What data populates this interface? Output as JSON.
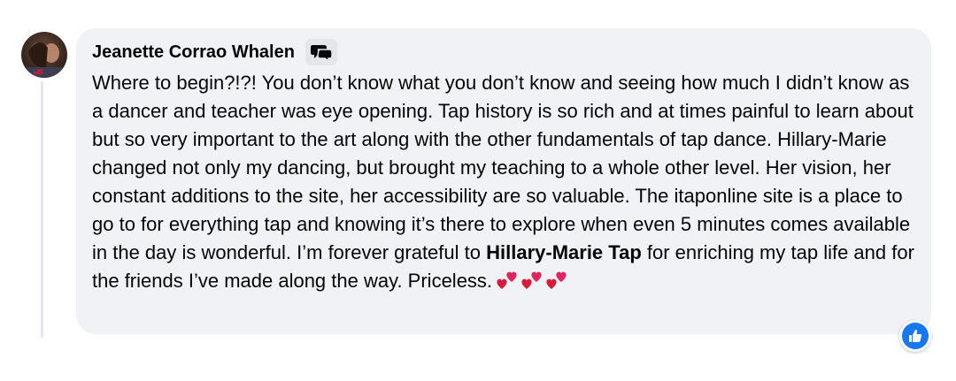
{
  "comment": {
    "author": "Jeanette Corrao Whalen",
    "text_before_mention": "Where to begin?!?! You don’t know what you don’t know and seeing how much I didn’t know as a dancer and teacher was eye opening. Tap history is so rich and at times painful to learn about but so very important to the art along with the other fundamentals of tap dance. Hillary-Marie changed not only my dancing, but brought my teaching to a whole other level. Her vision, her constant additions to the site, her accessibility are so valuable. The itaponline site is a place to go to for everything tap and knowing it’s there to explore when even 5 minutes comes available in the day is wonderful. I’m forever grateful to ",
    "mention": "Hillary-Marie Tap",
    "text_after_mention": " for enriching my tap life and for the friends I’ve made along the way. Priceless.",
    "emoji": [
      "two-hearts",
      "two-hearts",
      "two-hearts"
    ],
    "badge_icon": "top-fan-badge-icon",
    "reaction_icon": "like-thumb-icon"
  },
  "colors": {
    "bubble_bg": "#f0f2f5",
    "text": "#050505",
    "like_blue": "#1877f2",
    "heart_red": "#e0245e"
  }
}
